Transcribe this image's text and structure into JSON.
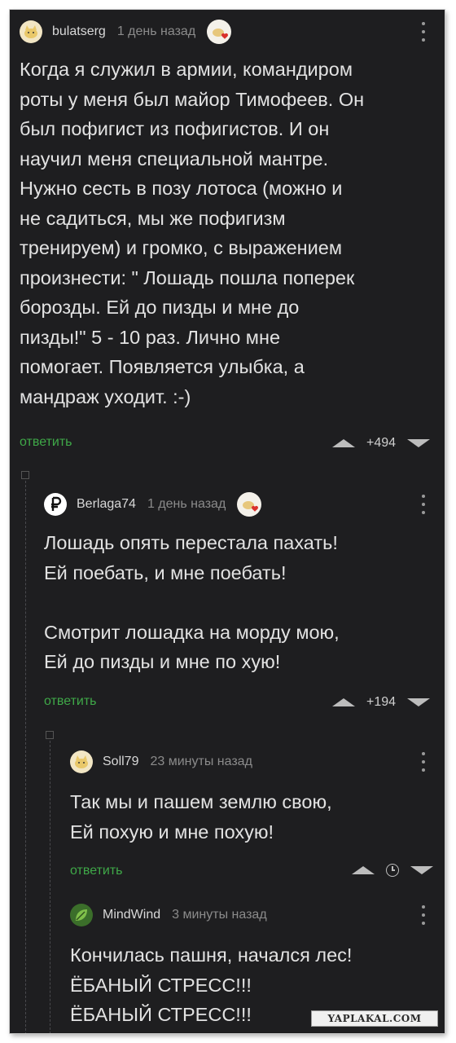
{
  "comments": [
    {
      "username": "bulatserg",
      "time": "1 день назад",
      "avatar_icon": "cat-avatar-icon",
      "badge_icon": "heart-badge-icon",
      "text": "Когда я служил в армии, командиром\nроты у меня был майор Тимофеев. Он\nбыл пофигист из пофигистов. И он\nнаучил меня специальной мантре.\nНужно сесть в позу лотоса (можно и\nне садиться, мы же пофигизм\nтренируем) и громко, с выражением\nпроизнести: \" Лошадь пошла поперек\nборозды. Ей до пизды и мне до\nпизды!\" 5 - 10 раз. Лично мне\nпомогает. Появляется улыбка, а\nмандраж уходит. :-)",
      "reply_label": "ответить",
      "score": "+494"
    },
    {
      "username": "Berlaga74",
      "time": "1 день назад",
      "avatar_icon": "ruble-avatar-icon",
      "badge_icon": "heart-badge-icon",
      "text": "Лошадь опять перестала пахать!\nЕй поебать, и мне поебать!\n\nСмотрит лошадка на морду мою,\nЕй до пизды и мне по хую!",
      "reply_label": "ответить",
      "score": "+194"
    },
    {
      "username": "Soll79",
      "time": "23 минуты назад",
      "avatar_icon": "cat-avatar-icon",
      "text": "Так мы и пашем землю свою,\nЕй похую и мне похую!",
      "reply_label": "ответить",
      "score_icon": "clock-icon"
    },
    {
      "username": "MindWind",
      "time": "3 минуты назад",
      "avatar_icon": "leaf-avatar-icon",
      "text": "Кончилась пашня, начался лес!\nЁБАНЫЙ СТРЕСС!!!\nЁБАНЫЙ СТРЕСС!!!"
    }
  ],
  "watermark": "YAPLAKAL.COM",
  "colors": {
    "background": "#1e1e20",
    "reply_link": "#3fa848",
    "text": "#e2e2e2",
    "meta": "#8b8b8b"
  }
}
